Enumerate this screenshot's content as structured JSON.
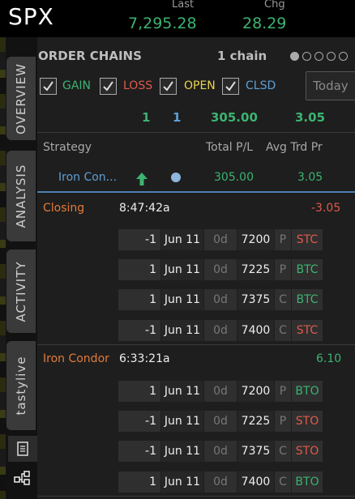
{
  "header": {
    "symbol": "SPX",
    "last_label": "Last",
    "last_value": "7,295.28",
    "chg_label": "Chg",
    "chg_value": "28.29"
  },
  "vertical_tabs": [
    "OVERVIEW",
    "ANALYSIS",
    "ACTIVITY",
    "tastylive"
  ],
  "order_chains": {
    "title": "ORDER CHAINS",
    "count_label": "1 chain",
    "filters": [
      {
        "label": "GAIN",
        "checked": true,
        "color": "#3cb371"
      },
      {
        "label": "LOSS",
        "checked": true,
        "color": "#e05a4a"
      },
      {
        "label": "OPEN",
        "checked": true,
        "color": "#e8d44d"
      },
      {
        "label": "CLSD",
        "checked": true,
        "color": "#5e9fd6"
      }
    ],
    "today_button": "Today",
    "summary": {
      "gain_count": "1",
      "closed_count": "1",
      "total_pl": "305.00",
      "avg": "3.05"
    },
    "columns": {
      "strategy": "Strategy",
      "total_pl": "Total P/L",
      "avg_trd_pr": "Avg Trd Pr"
    },
    "chain_row": {
      "strategy": "Iron Con...",
      "total_pl": "305.00",
      "avg_trd_pr": "3.05"
    }
  },
  "groups": [
    {
      "name": "Closing",
      "time": "8:47:42a",
      "price": "-3.05",
      "price_color": "#e05a4a",
      "name_color": "#e07b39",
      "legs": [
        {
          "qty": "-1",
          "date": "Jun 11",
          "dte": "0d",
          "strike": "7200",
          "type": "P",
          "action": "STC"
        },
        {
          "qty": "1",
          "date": "Jun 11",
          "dte": "0d",
          "strike": "7225",
          "type": "P",
          "action": "BTC"
        },
        {
          "qty": "1",
          "date": "Jun 11",
          "dte": "0d",
          "strike": "7375",
          "type": "C",
          "action": "BTC"
        },
        {
          "qty": "-1",
          "date": "Jun 11",
          "dte": "0d",
          "strike": "7400",
          "type": "C",
          "action": "STC"
        }
      ]
    },
    {
      "name": "Iron Condor",
      "time": "6:33:21a",
      "price": "6.10",
      "price_color": "#3cb371",
      "name_color": "#e07b39",
      "legs": [
        {
          "qty": "1",
          "date": "Jun 11",
          "dte": "0d",
          "strike": "7200",
          "type": "P",
          "action": "BTO"
        },
        {
          "qty": "-1",
          "date": "Jun 11",
          "dte": "0d",
          "strike": "7225",
          "type": "P",
          "action": "STO"
        },
        {
          "qty": "-1",
          "date": "Jun 11",
          "dte": "0d",
          "strike": "7375",
          "type": "C",
          "action": "STO"
        },
        {
          "qty": "1",
          "date": "Jun 11",
          "dte": "0d",
          "strike": "7400",
          "type": "C",
          "action": "BTO"
        }
      ]
    }
  ],
  "icons": [
    "checkbox-check-icon",
    "up-arrow-icon",
    "status-dot-icon",
    "document-icon",
    "network-icon",
    "page-indicator-dot"
  ]
}
